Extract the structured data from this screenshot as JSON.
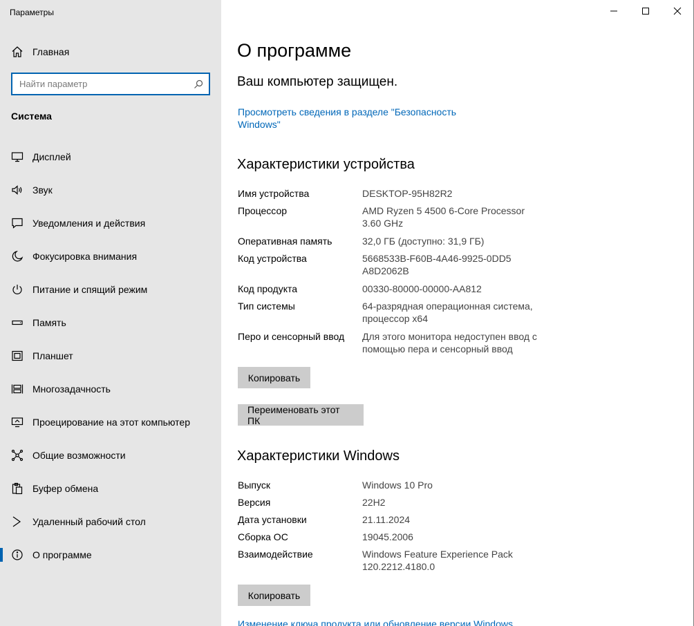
{
  "window": {
    "title": "Параметры"
  },
  "sidebar": {
    "home_label": "Главная",
    "search": {
      "placeholder": "Найти параметр",
      "value": ""
    },
    "section_label": "Система",
    "items": [
      {
        "label": "Дисплей",
        "icon": "monitor-icon"
      },
      {
        "label": "Звук",
        "icon": "speaker-icon"
      },
      {
        "label": "Уведомления и действия",
        "icon": "notification-icon"
      },
      {
        "label": "Фокусировка внимания",
        "icon": "moon-icon"
      },
      {
        "label": "Питание и спящий режим",
        "icon": "power-icon"
      },
      {
        "label": "Память",
        "icon": "storage-icon"
      },
      {
        "label": "Планшет",
        "icon": "tablet-icon"
      },
      {
        "label": "Многозадачность",
        "icon": "multitasking-icon"
      },
      {
        "label": "Проецирование на этот компьютер",
        "icon": "projection-icon"
      },
      {
        "label": "Общие возможности",
        "icon": "shared-experiences-icon"
      },
      {
        "label": "Буфер обмена",
        "icon": "clipboard-icon"
      },
      {
        "label": "Удаленный рабочий стол",
        "icon": "remote-desktop-icon"
      },
      {
        "label": "О программе",
        "icon": "info-icon",
        "active": true
      }
    ]
  },
  "main": {
    "title": "О программе",
    "protected_text": "Ваш компьютер защищен.",
    "security_link": "Просмотреть сведения в разделе \"Безопасность Windows\"",
    "device": {
      "heading": "Характеристики устройства",
      "rows": [
        {
          "key": "Имя устройства",
          "value": "DESKTOP-95H82R2"
        },
        {
          "key": "Процессор",
          "value": "AMD Ryzen 5 4500 6-Core Processor 3.60 GHz"
        },
        {
          "key": "Оперативная память",
          "value": "32,0 ГБ (доступно: 31,9 ГБ)"
        },
        {
          "key": "Код устройства",
          "value": "5668533B-F60B-4A46-9925-0DD5A8D2062B"
        },
        {
          "key": "Код продукта",
          "value": "00330-80000-00000-AA812"
        },
        {
          "key": "Тип системы",
          "value": "64-разрядная операционная система, процессор x64"
        },
        {
          "key": "Перо и сенсорный ввод",
          "value": "Для этого монитора недоступен ввод с помощью пера и сенсорный ввод"
        }
      ],
      "copy_button": "Копировать",
      "rename_button": "Переименовать этот ПК"
    },
    "windows": {
      "heading": "Характеристики Windows",
      "rows": [
        {
          "key": "Выпуск",
          "value": "Windows 10 Pro"
        },
        {
          "key": "Версия",
          "value": "22H2"
        },
        {
          "key": "Дата установки",
          "value": "21.11.2024"
        },
        {
          "key": "Сборка ОС",
          "value": "19045.2006"
        },
        {
          "key": "Взаимодействие",
          "value": "Windows Feature Experience Pack 120.2212.4180.0"
        }
      ],
      "copy_button": "Копировать"
    },
    "bottom_link": "Изменение ключа продукта или обновление версии Windows"
  },
  "caption_buttons": [
    "minimize-icon",
    "maximize-icon",
    "close-icon"
  ]
}
